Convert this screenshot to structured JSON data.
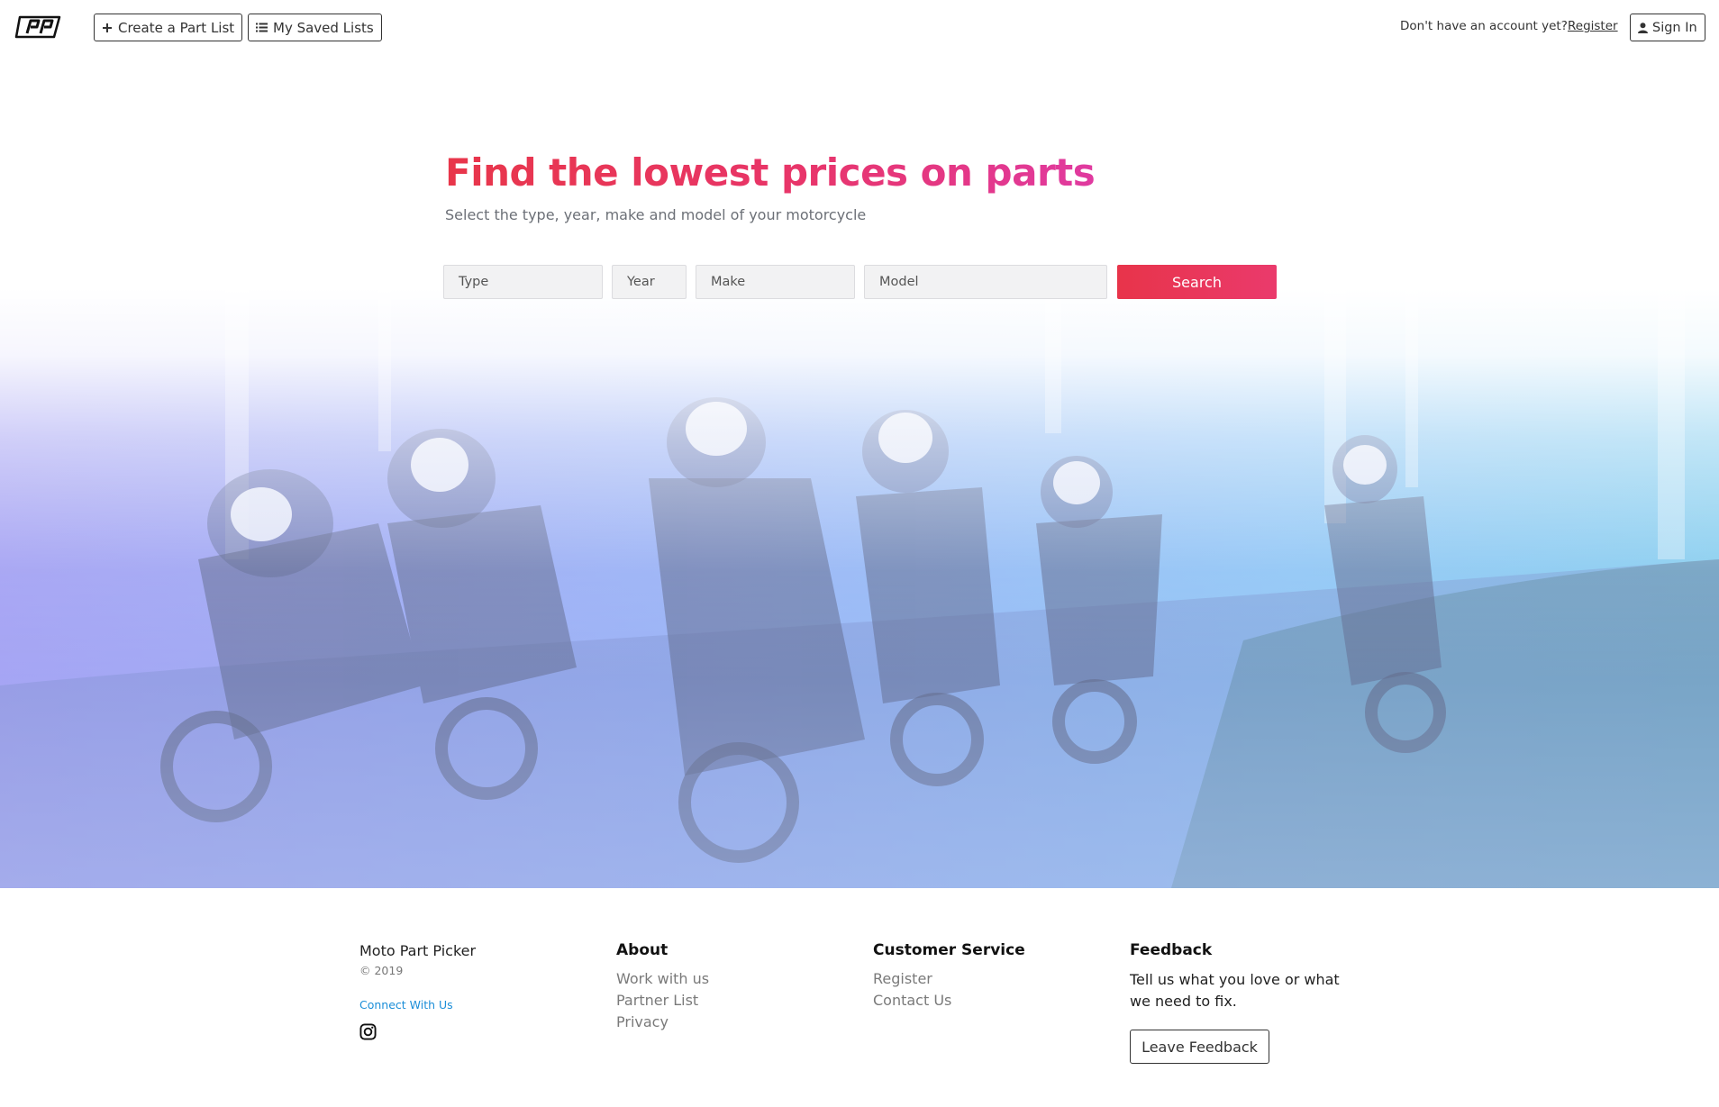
{
  "header": {
    "logo_icon": "pp-logo-icon",
    "create_list_label": "Create a Part List",
    "saved_lists_label": "My Saved Lists",
    "no_account_text": "Don't have an account yet?",
    "register_label": "Register",
    "sign_in_label": "Sign In"
  },
  "hero": {
    "headline": "Find the lowest prices on parts",
    "subline": "Select the type, year, make and model of your motorcycle",
    "background_image": "motocross-riders-photo",
    "search": {
      "type_placeholder": "Type",
      "year_placeholder": "Year",
      "make_placeholder": "Make",
      "model_placeholder": "Model",
      "button_label": "Search"
    }
  },
  "footer": {
    "brand": "Moto Part Picker",
    "copyright": "© 2019",
    "connect_label": "Connect With Us",
    "social_icon": "instagram-icon",
    "about": {
      "title": "About",
      "links": [
        "Work with us",
        "Partner List",
        "Privacy"
      ]
    },
    "customer_service": {
      "title": "Customer Service",
      "links": [
        "Register",
        "Contact Us"
      ]
    },
    "feedback": {
      "title": "Feedback",
      "text": "Tell us what you love or what we need to fix.",
      "button_label": "Leave Feedback"
    }
  },
  "colors": {
    "accent_red": "#e8364a",
    "accent_pink": "#e03aa0",
    "link_blue": "#1b8ed8",
    "hero_blue_left": "#7b74ec",
    "hero_blue_right": "#4fb9e6"
  }
}
